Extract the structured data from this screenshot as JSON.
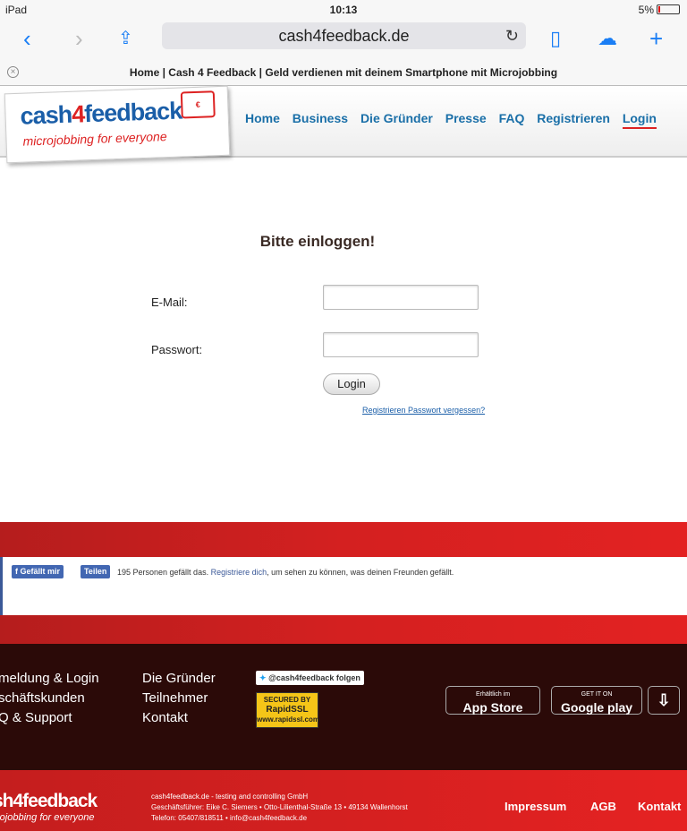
{
  "status": {
    "device": "iPad",
    "time": "10:13",
    "battery": "5%"
  },
  "browser": {
    "url": "cash4feedback.de",
    "tab_title": "Home | Cash 4 Feedback | Geld verdienen mit deinem Smartphone mit Microjobbing"
  },
  "logo": {
    "main_a": "cash",
    "main_b": "4",
    "main_c": "feedback",
    "slogan": "microjobbing for everyone"
  },
  "menu": [
    "Home",
    "Business",
    "Die Gründer",
    "Presse",
    "FAQ",
    "Registrieren",
    "Login"
  ],
  "form": {
    "heading": "Bitte einloggen!",
    "email_label": "E-Mail:",
    "email_value": "",
    "password_label": "Passwort:",
    "password_value": "",
    "login_button": "Login",
    "register_link": "Registrieren",
    "forgot_link": "Passwort vergessen?"
  },
  "facebook": {
    "like": "Gefällt mir",
    "share": "Teilen",
    "text_a": "195 Personen gefällt das.",
    "link": "Registriere dich",
    "text_b": ", um sehen zu können, was deinen Freunden gefällt."
  },
  "footer": {
    "col1": [
      "meldung & Login",
      "schäftskunden",
      "Q & Support"
    ],
    "col2": [
      "Die Gründer",
      "Teilnehmer",
      "Kontakt"
    ],
    "twitter": "@cash4feedback folgen",
    "ssl_a": "SECURED BY",
    "ssl_b": "RapidSSL",
    "ssl_c": "www.rapidssl.com",
    "appstore": "App Store",
    "appstore_small": "Erhältlich im",
    "googleplay": "Google play",
    "googleplay_small": "GET IT ON"
  },
  "bottom": {
    "logo": "sh4feedback",
    "slogan": "rojobbing for everyone",
    "company": "cash4feedback.de - testing and controlling GmbH",
    "ceo": "Geschäftsführer: Eike C. Siemers • Otto-Lilienthal-Straße 13 • 49134 Wallenhorst",
    "phone": "Telefon: 05407/818511 • info@cash4feedback.de",
    "links": [
      "Impressum",
      "AGB",
      "Kontakt"
    ]
  }
}
